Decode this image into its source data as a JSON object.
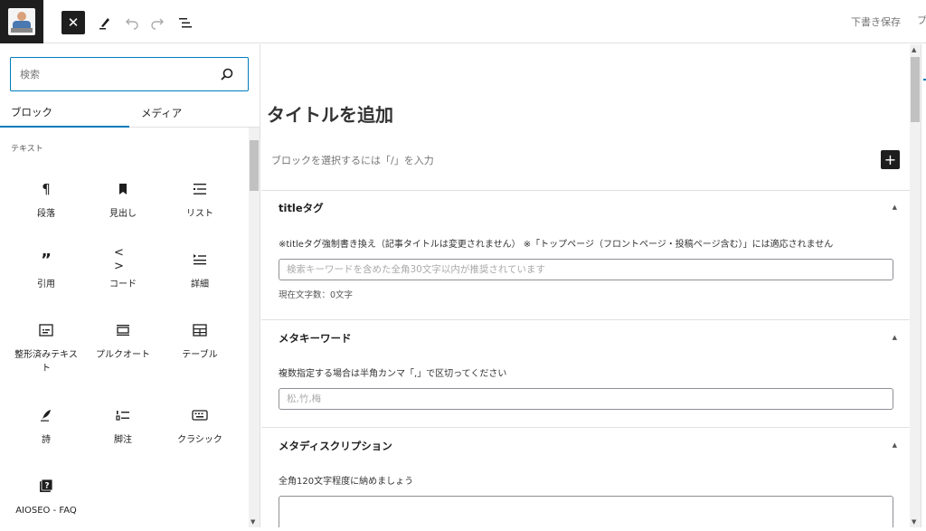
{
  "toolbar": {
    "save_draft_label": "下書き保存",
    "preview_label": "プ"
  },
  "inserter": {
    "search_placeholder": "検索",
    "tabs": [
      {
        "label": "ブロック"
      },
      {
        "label": "メディア"
      }
    ],
    "category": "テキスト",
    "blocks": [
      {
        "label": "段落",
        "icon": "paragraph-icon"
      },
      {
        "label": "見出し",
        "icon": "heading-icon"
      },
      {
        "label": "リスト",
        "icon": "list-icon"
      },
      {
        "label": "引用",
        "icon": "quote-icon"
      },
      {
        "label": "コード",
        "icon": "code-icon"
      },
      {
        "label": "詳細",
        "icon": "details-icon"
      },
      {
        "label": "整形済みテキスト",
        "icon": "preformatted-icon"
      },
      {
        "label": "プルクオート",
        "icon": "pullquote-icon"
      },
      {
        "label": "テーブル",
        "icon": "table-icon"
      },
      {
        "label": "詩",
        "icon": "verse-icon"
      },
      {
        "label": "脚注",
        "icon": "footnotes-icon"
      },
      {
        "label": "クラシック",
        "icon": "classic-icon"
      },
      {
        "label": "AIOSEO - FAQ",
        "icon": "faq-icon"
      }
    ]
  },
  "editor": {
    "title_placeholder": "タイトルを追加",
    "block_hint": "ブロックを選択するには「/」を入力",
    "panels": {
      "title_tag": {
        "title": "titleタグ",
        "description": "※titleタグ強制書き換え（記事タイトルは変更されません） ※「トップページ（フロントページ・投稿ページ含む）」には適応されません",
        "placeholder": "検索キーワードを含めた全角30文字以内が推奨されています",
        "counter": "現在文字数：0文字"
      },
      "meta_keywords": {
        "title": "メタキーワード",
        "description": "複数指定する場合は半角カンマ「,」で区切ってください",
        "placeholder": "松,竹,梅"
      },
      "meta_description": {
        "title": "メタディスクリプション",
        "description": "全角120文字程度に納めましょう"
      }
    }
  }
}
